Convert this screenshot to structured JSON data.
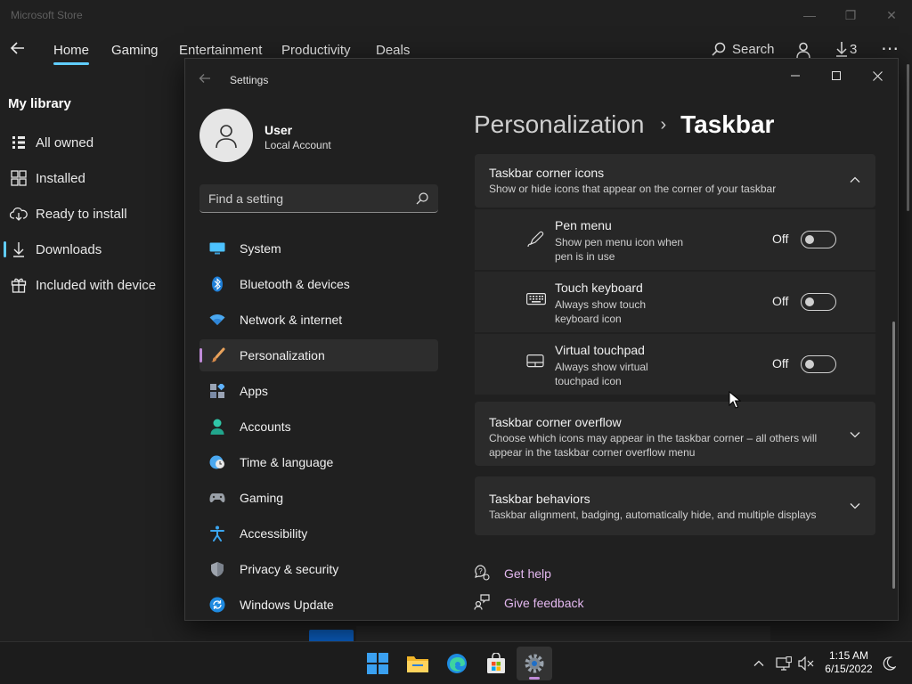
{
  "store": {
    "title": "Microsoft Store",
    "tabs": [
      "Home",
      "Gaming",
      "Entertainment",
      "Productivity",
      "Deals"
    ],
    "search_label": "Search",
    "downloads_count": "3",
    "library_title": "My library",
    "library_items": [
      "All owned",
      "Installed",
      "Ready to install",
      "Downloads",
      "Included with device"
    ]
  },
  "settings": {
    "window_title": "Settings",
    "user": {
      "name": "User",
      "account": "Local Account"
    },
    "search_placeholder": "Find a setting",
    "nav": [
      {
        "label": "System",
        "icon": "monitor-icon"
      },
      {
        "label": "Bluetooth & devices",
        "icon": "bluetooth-icon"
      },
      {
        "label": "Network & internet",
        "icon": "wifi-icon"
      },
      {
        "label": "Personalization",
        "icon": "brush-icon",
        "selected": true
      },
      {
        "label": "Apps",
        "icon": "apps-icon"
      },
      {
        "label": "Accounts",
        "icon": "person-icon"
      },
      {
        "label": "Time & language",
        "icon": "clock-globe-icon"
      },
      {
        "label": "Gaming",
        "icon": "gamepad-icon"
      },
      {
        "label": "Accessibility",
        "icon": "accessibility-icon"
      },
      {
        "label": "Privacy & security",
        "icon": "shield-icon"
      },
      {
        "label": "Windows Update",
        "icon": "update-icon"
      }
    ],
    "breadcrumb": {
      "parent": "Personalization",
      "separator": "›",
      "current": "Taskbar"
    },
    "corner_icons": {
      "title": "Taskbar corner icons",
      "description": "Show or hide icons that appear on the corner of your taskbar",
      "items": [
        {
          "title": "Pen menu",
          "description": "Show pen menu icon when pen is in use",
          "state": "Off",
          "icon": "pen-icon"
        },
        {
          "title": "Touch keyboard",
          "description": "Always show touch keyboard icon",
          "state": "Off",
          "icon": "keyboard-icon"
        },
        {
          "title": "Virtual touchpad",
          "description": "Always show virtual touchpad icon",
          "state": "Off",
          "icon": "touchpad-icon"
        }
      ]
    },
    "corner_overflow": {
      "title": "Taskbar corner overflow",
      "description": "Choose which icons may appear in the taskbar corner – all others will appear in the taskbar corner overflow menu"
    },
    "behaviors": {
      "title": "Taskbar behaviors",
      "description": "Taskbar alignment, badging, automatically hide, and multiple displays"
    },
    "links": {
      "help": "Get help",
      "feedback": "Give feedback"
    }
  },
  "taskbar": {
    "time": "1:15 AM",
    "date": "6/15/2022"
  },
  "colors": {
    "accent_store": "#60cdff",
    "accent_settings": "#c08bd8",
    "link": "#e4b8f0"
  }
}
